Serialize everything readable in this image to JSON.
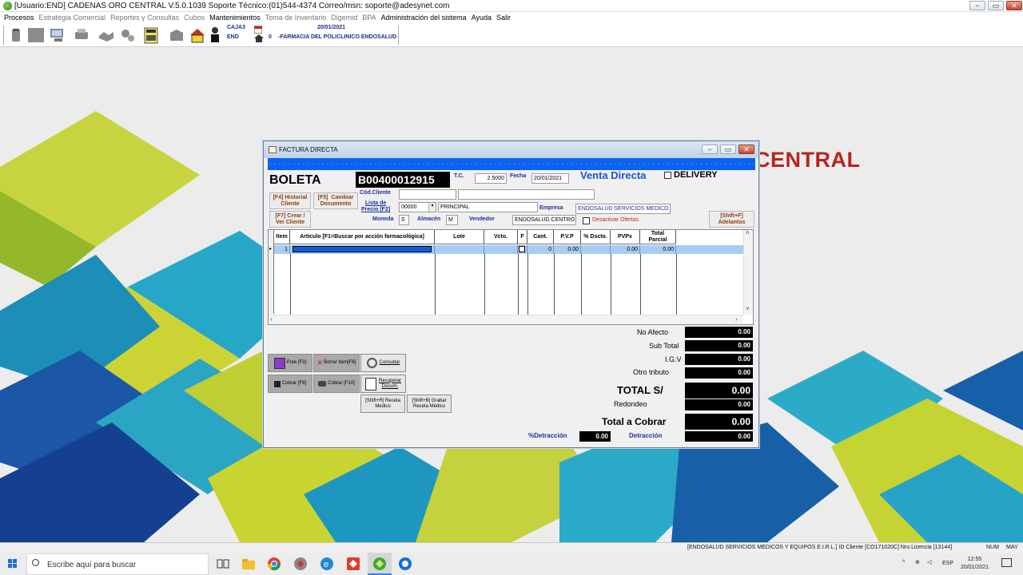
{
  "titlebar": {
    "title": "[Usuario:END] CADENAS ORO CENTRAL V.5.0.1039 Soporte Técnico:(01)544-4374 Correo/msn: soporte@adesynet.com",
    "min": "−",
    "max": "▭",
    "close": "✕"
  },
  "menu": [
    {
      "label": "Procesos",
      "enabled": true
    },
    {
      "label": "Estrategia Comercial",
      "enabled": false
    },
    {
      "label": "Reportes y Consultas",
      "enabled": false
    },
    {
      "label": "Cubos",
      "enabled": false
    },
    {
      "label": "Mantenimientos",
      "enabled": true
    },
    {
      "label": "Toma de Inventario",
      "enabled": false
    },
    {
      "label": "Digemid",
      "enabled": false
    },
    {
      "label": "BPA",
      "enabled": false
    },
    {
      "label": "Administración del sistema",
      "enabled": true
    },
    {
      "label": "Ayuda",
      "enabled": true
    },
    {
      "label": "Salir",
      "enabled": true
    }
  ],
  "toolbar_info": {
    "caja": "CAJA3",
    "user": "END",
    "date": "20/01/2021",
    "local_num": "0",
    "local_name": "-FARMACIA DEL POLICLINICO ENDOSALUD"
  },
  "brand": "CENTRAL",
  "dialog": {
    "title": "FACTURA DIRECTA",
    "doc_type": "BOLETA",
    "doc_number": "B00400012915",
    "tc_label": "T.C.",
    "tc_value": "2.5000",
    "fecha_label": "Fecha",
    "fecha_value": "20/01/2021",
    "venta_label": "Venta Directa",
    "delivery_label": "DELIVERY",
    "btn_historial": "[F4] Historial\nCliente",
    "btn_cambiar": "[F5]  Cambiar\nDocumento",
    "btn_crear": "[F7] Crear /\nVer Cliente",
    "btn_adelantos": "[Shift+F]\nAdelantos",
    "cod_cliente_label": "Cód.Cliente",
    "cod_cliente_value": "",
    "cliente_nombre": "",
    "lista_precio_label": "Lista de\nPrecio [F2]",
    "lista_precio_code": "00000",
    "lista_precio_name": "PRINCIPAL",
    "empresa_label": "Empresa",
    "empresa_value": "ENDOSALUD SERVICIOS MEDICO",
    "moneda_label": "Moneda",
    "moneda_value": "S",
    "almacen_label": "Almacén",
    "almacen_value": "M",
    "vendedor_label": "Vendedor",
    "vendedor_value": "ENDOSALUD CENTRO CLI",
    "desactivar_label": "Desactivar Ofertas"
  },
  "grid": {
    "columns": [
      "Item",
      "Articulo [F1=Buscar por acción farmacológica]",
      "Lote",
      "Vcto.",
      "F",
      "Cant.",
      "P.V.P",
      "% Dscto.",
      "PVPx",
      "Total\nParcial"
    ],
    "rows": [
      {
        "item": "1",
        "articulo": "",
        "lote": "",
        "vcto": "",
        "f": "",
        "cant": "0",
        "pvp": "0.00",
        "dscto": "",
        "pvpx": "0.00",
        "total": "0.00"
      }
    ]
  },
  "totals": {
    "no_afecto_label": "No Afecto",
    "no_afecto": "0.00",
    "subtotal_label": "Sub Total",
    "subtotal": "0.00",
    "igv_label": "I.G.V",
    "igv": "0.00",
    "otro_label": "Otro tributo",
    "otro": "0.00",
    "total_label": "TOTAL S/",
    "total": "0.00",
    "redondeo_label": "Redondeo",
    "redondeo": "0.00",
    "cobrar_label": "Total a Cobrar",
    "cobrar": "0.00",
    "pct_detraccion_label": "%Detracción",
    "pct_detraccion": "0.00",
    "detraccion_label": "Detracción",
    "detraccion": "0.00"
  },
  "actions": {
    "pute": "Pute [F3]",
    "borrar": "Borrar Item[F6]",
    "consultar": "Consultar",
    "cobrar1": "Cobrar [F8]",
    "cobrar2": "Cobrar [F10]",
    "recuperar": "Recuperar\nDocum.",
    "receta": "[Shift+R] Receta\nMedico",
    "grabar_receta": "[Shift+B] Grabar\nReceta Médico"
  },
  "statusbar": {
    "company": "[ENDOSALUD SERVICIOS MEDICOS Y EQUIPOS E.I.R.L.] ID Cliente [CO171020C] Nro.Licencia [13144]",
    "num": "NUM",
    "may": "MAY"
  },
  "taskbar": {
    "search_placeholder": "Escribe aquí para buscar",
    "lang": "ESP",
    "time": "12:55",
    "date": "20/01/2021"
  },
  "colors": {
    "band_blue": "#0a62f0",
    "brand_red": "#b72422",
    "row_highlight": "#a9ccf2"
  }
}
